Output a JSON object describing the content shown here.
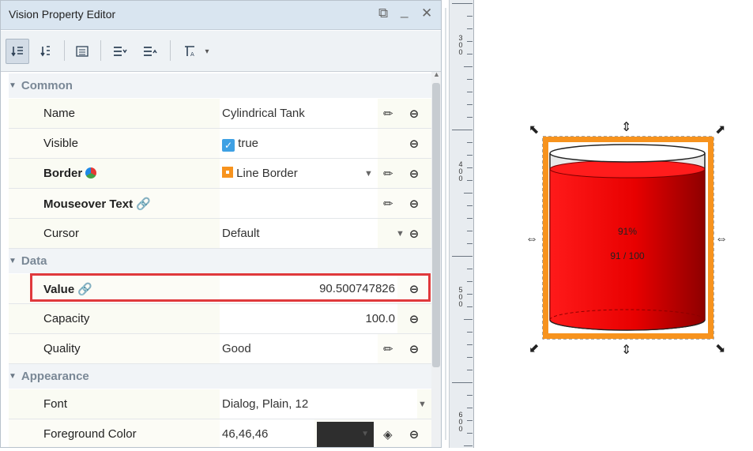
{
  "panel": {
    "title": "Vision Property Editor",
    "window_buttons": {
      "restore": "⧉",
      "minimize": "_",
      "close": "✕"
    }
  },
  "toolbar": {
    "buttons": [
      {
        "icon": "sort-category-icon"
      },
      {
        "icon": "sort-alpha-icon"
      },
      {
        "icon": "list-view-icon"
      },
      {
        "icon": "expand-all-icon"
      },
      {
        "icon": "collapse-all-icon"
      },
      {
        "icon": "filter-icon",
        "has_dropdown": true
      }
    ]
  },
  "groups": {
    "common": "Common",
    "data": "Data",
    "appearance": "Appearance"
  },
  "props": {
    "name": {
      "label": "Name",
      "value": "Cylindrical Tank"
    },
    "visible": {
      "label": "Visible",
      "value": "true"
    },
    "border": {
      "label": "Border",
      "value": "Line Border"
    },
    "mouseover": {
      "label": "Mouseover Text",
      "value": ""
    },
    "cursor": {
      "label": "Cursor",
      "value": "Default"
    },
    "value": {
      "label": "Value",
      "value": "90.500747826"
    },
    "capacity": {
      "label": "Capacity",
      "value": "100.0"
    },
    "quality": {
      "label": "Quality",
      "value": "Good"
    },
    "font": {
      "label": "Font",
      "value": "Dialog, Plain, 12"
    },
    "fg_color": {
      "label": "Foreground Color",
      "value": "46,46,46",
      "swatch": "#2e2e2e"
    }
  },
  "ruler": {
    "labels": [
      "3\n0\n0",
      "4\n0\n0",
      "5\n0\n0",
      "6\n0\n0"
    ]
  },
  "tank": {
    "percent_text": "91%",
    "ratio_text": "91 / 100",
    "fill_fraction": 0.905,
    "liquid_color": "#ee0000",
    "selection_color": "#f7931e"
  },
  "colors": {
    "highlight": "#e0393c",
    "accent": "#f7931e"
  }
}
